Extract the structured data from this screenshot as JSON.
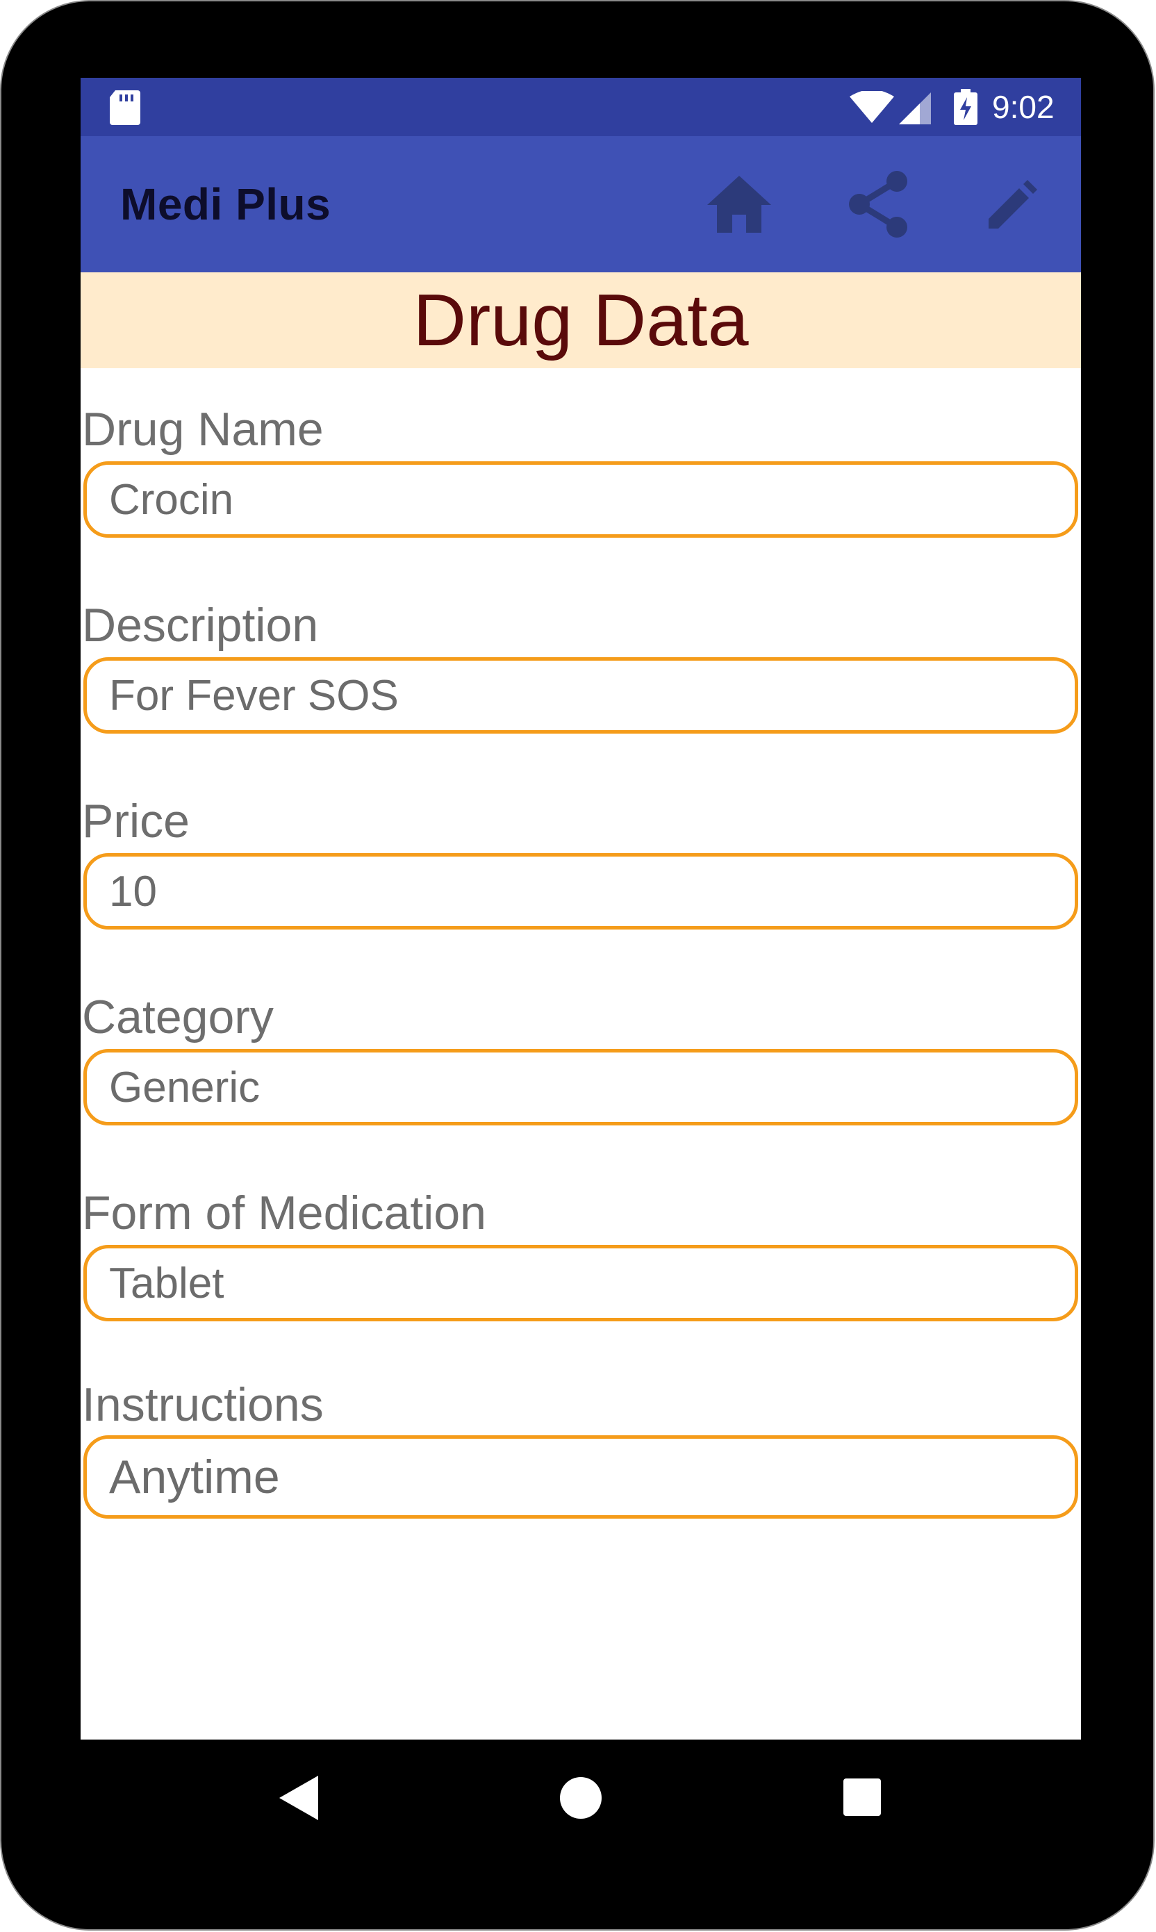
{
  "status_bar": {
    "time": "9:02",
    "icons": [
      "sd-card-icon",
      "wifi-icon",
      "cell-signal-icon",
      "battery-charging-icon"
    ]
  },
  "app_bar": {
    "title": "Medi Plus",
    "actions": [
      {
        "icon": "home-icon"
      },
      {
        "icon": "share-icon"
      },
      {
        "icon": "edit-icon"
      }
    ]
  },
  "page": {
    "title": "Drug Data"
  },
  "fields": {
    "drug_name": {
      "label": "Drug Name",
      "value": "Crocin"
    },
    "description": {
      "label": "Description",
      "value": "For Fever SOS"
    },
    "price": {
      "label": "Price",
      "value": "10"
    },
    "category": {
      "label": "Category",
      "value": "Generic"
    },
    "form": {
      "label": "Form of Medication",
      "value": "Tablet"
    },
    "instructions": {
      "label": "Instructions",
      "value": "Anytime"
    }
  },
  "colors": {
    "status_bar": "#303f9f",
    "app_bar": "#3f51b5",
    "header_bg": "#ffebcc",
    "header_text": "#5a0a0a",
    "field_border": "#f59c1a",
    "icon_color": "#2c3a7a"
  },
  "nav_bar": {
    "buttons": [
      "back-icon",
      "home-circle-icon",
      "recents-icon"
    ]
  }
}
